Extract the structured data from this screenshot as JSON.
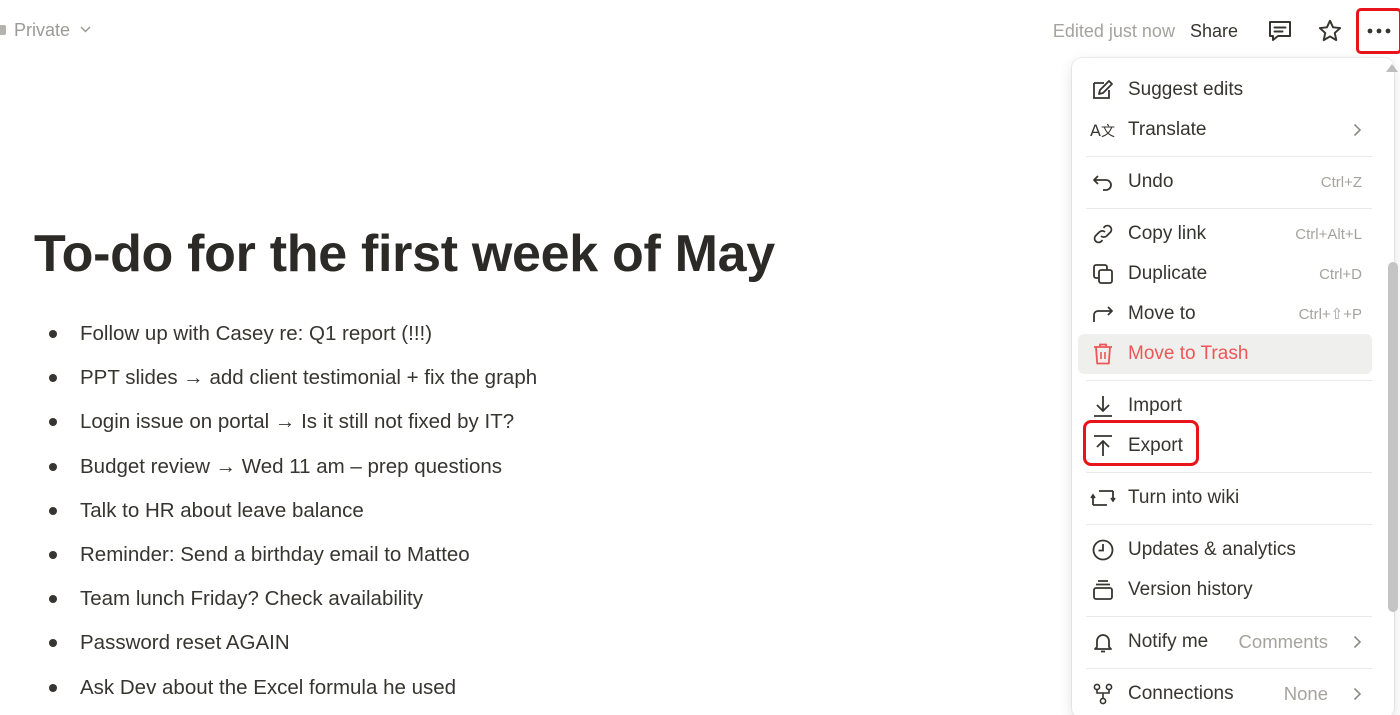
{
  "topbar": {
    "privacy_label": "Private",
    "edited_label": "Edited just now",
    "share_label": "Share"
  },
  "page": {
    "title": "To-do for the first week of May",
    "todos": [
      "Follow up with Casey re: Q1 report (!!!)",
      "PPT slides → add client testimonial + fix the graph",
      "Login issue on portal → Is it still not fixed by IT?",
      "Budget review → Wed 11 am – prep questions",
      "Talk to HR about leave balance",
      "Reminder: Send a birthday email to Matteo",
      "Team lunch Friday? Check availability",
      "Password reset AGAIN",
      "Ask Dev about the Excel formula he used"
    ]
  },
  "menu": {
    "suggest_edits": "Suggest edits",
    "translate": "Translate",
    "undo": "Undo",
    "undo_shortcut": "Ctrl+Z",
    "copy_link": "Copy link",
    "copy_link_shortcut": "Ctrl+Alt+L",
    "duplicate": "Duplicate",
    "duplicate_shortcut": "Ctrl+D",
    "move_to": "Move to",
    "move_to_shortcut": "Ctrl+⇧+P",
    "move_to_trash": "Move to Trash",
    "import": "Import",
    "export": "Export",
    "turn_into_wiki": "Turn into wiki",
    "updates_analytics": "Updates & analytics",
    "version_history": "Version history",
    "notify_me": "Notify me",
    "notify_me_value": "Comments",
    "connections": "Connections",
    "connections_value": "None"
  },
  "icons": {
    "privacy": "lock-icon",
    "comment": "comment-icon",
    "favorite": "star-icon",
    "more": "more-horizontal-icon"
  },
  "colors": {
    "highlight_red": "#e8141a",
    "trash_red": "#eb5757",
    "muted_text": "#a5a39e"
  }
}
